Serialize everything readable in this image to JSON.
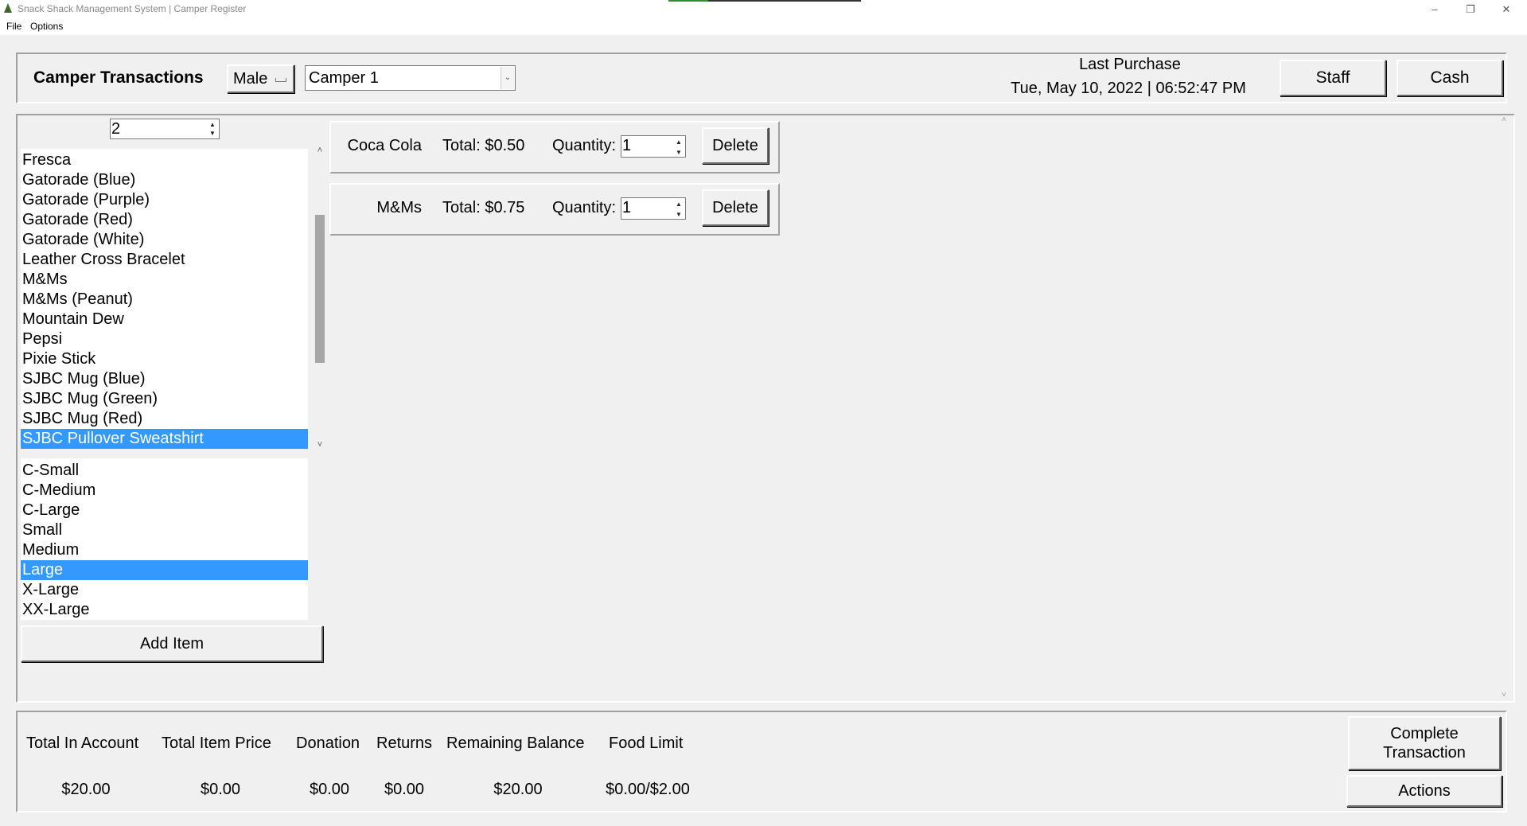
{
  "window": {
    "title": "Snack Shack Management System | Camper Register",
    "minimize": "–",
    "restore": "❐",
    "close": "✕"
  },
  "menu": {
    "file": "File",
    "options": "Options"
  },
  "header": {
    "title": "Camper Transactions",
    "gender": "Male",
    "camper": "Camper 1",
    "last_purchase_label": "Last Purchase",
    "last_purchase_date": "Tue, May 10, 2022 | 06:52:47 PM",
    "staff_label": "Staff",
    "cash_label": "Cash"
  },
  "add_panel": {
    "quantity": "2",
    "items": [
      "Fresca",
      "Gatorade (Blue)",
      "Gatorade (Purple)",
      "Gatorade (Red)",
      "Gatorade (White)",
      "Leather Cross Bracelet",
      "M&Ms",
      "M&Ms (Peanut)",
      "Mountain Dew",
      "Pepsi",
      "Pixie Stick",
      "SJBC Mug (Blue)",
      "SJBC Mug (Green)",
      "SJBC Mug (Red)",
      "SJBC Pullover Sweatshirt"
    ],
    "selected_item": "SJBC Pullover Sweatshirt",
    "sizes": [
      "C-Small",
      "C-Medium",
      "C-Large",
      "Small",
      "Medium",
      "Large",
      "X-Large",
      "XX-Large"
    ],
    "selected_size": "Large",
    "add_label": "Add Item"
  },
  "cart": [
    {
      "name": "Coca Cola",
      "total": "Total: $0.50",
      "quantity_label": "Quantity:",
      "quantity": "1",
      "delete_label": "Delete"
    },
    {
      "name": "M&Ms",
      "total": "Total: $0.75",
      "quantity_label": "Quantity:",
      "quantity": "1",
      "delete_label": "Delete"
    }
  ],
  "summary": {
    "total_in_account_label": "Total In Account",
    "total_in_account": "$20.00",
    "total_item_price_label": "Total Item Price",
    "total_item_price": "$0.00",
    "donation_label": "Donation",
    "donation": "$0.00",
    "returns_label": "Returns",
    "returns": "$0.00",
    "remaining_balance_label": "Remaining Balance",
    "remaining_balance": "$20.00",
    "food_limit_label": "Food Limit",
    "food_limit": "$0.00/$2.00",
    "complete_line1": "Complete",
    "complete_line2": "Transaction",
    "actions_label": "Actions"
  },
  "colors": {
    "selection": "#3399ff",
    "window_bg": "#f0f0f0",
    "progress": "#2e8b2e"
  }
}
